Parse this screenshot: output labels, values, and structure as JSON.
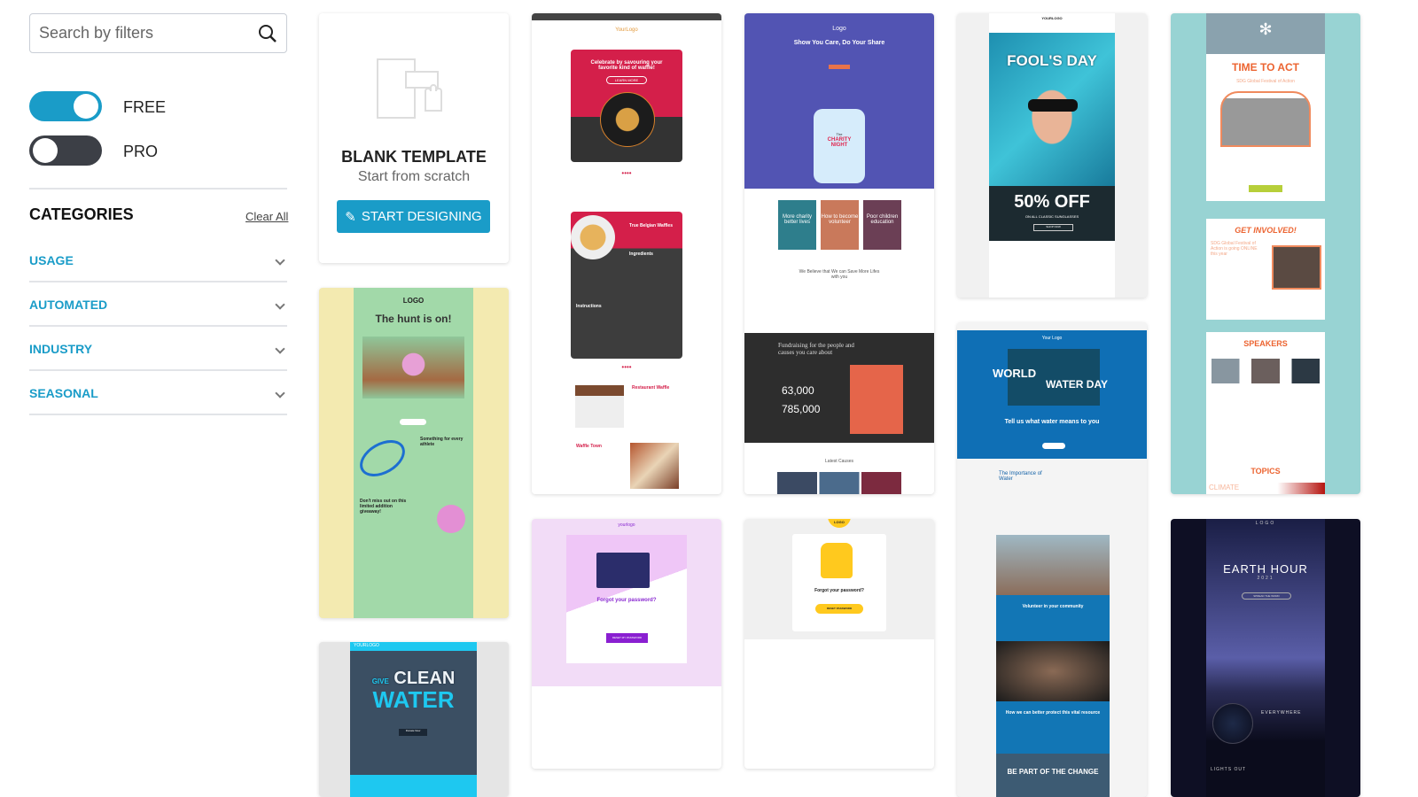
{
  "search": {
    "placeholder": "Search by filters",
    "icon": "search-icon"
  },
  "filters": [
    {
      "label": "FREE",
      "on": true
    },
    {
      "label": "PRO",
      "on": false
    }
  ],
  "colors": {
    "accent": "#1a9cc8",
    "toggle_off": "#3c3f46"
  },
  "categories": {
    "title": "CATEGORIES",
    "clear_label": "Clear All",
    "items": [
      {
        "label": "USAGE"
      },
      {
        "label": "AUTOMATED"
      },
      {
        "label": "INDUSTRY"
      },
      {
        "label": "SEASONAL"
      }
    ]
  },
  "blank": {
    "title": "BLANK TEMPLATE",
    "subtitle": "Start from scratch",
    "button": "START DESIGNING"
  },
  "templates": {
    "easter": {
      "logo": "LOGO",
      "headline": "The hunt is on!",
      "sub1": "Something for every athlete",
      "sub2": "Don't miss out on this limited addition giveaway!",
      "cta": "SHOP NOW"
    },
    "water": {
      "logo": "YOURLOGO",
      "line1": "GIVE",
      "line2": "CLEAN",
      "line3": "WATER",
      "cta": "Donate Now"
    },
    "waffle": {
      "logo": "YourLogo",
      "headline": "Celebrate by savouring your favorite kind of waffle!",
      "cta": "LEARN MORE",
      "recipe": "True Belgian Waffles",
      "ingredients": "Ingredients",
      "instructions": "Instructions",
      "r1": "Restaurant Waffle",
      "r2": "Waffle Town"
    },
    "pw_purple": {
      "logo": "yourlogo",
      "headline": "Forgot your password?",
      "cta": "RESET MY PASSWORD"
    },
    "charity": {
      "logo": "Logo",
      "headline": "Show You Care, Do Your Share",
      "jar1": "The",
      "jar2": "CHARITY NIGHT",
      "tiles": [
        "More charity better lives",
        "How to become volunteer",
        "Poor children education"
      ],
      "believe": "We Believe that We can Save More Lifes with you",
      "fund": "Fundraising for the people and causes you care about",
      "stat1": "63,000",
      "stat2": "785,000",
      "latest": "Latest Causes"
    },
    "pw_yellow": {
      "logo": "LOGO",
      "headline": "Forgot your password?",
      "cta": "RESET PASSWORD"
    },
    "fools": {
      "logo": "YOURLOGO",
      "headline": "FOOL'S DAY",
      "offer": "50% OFF",
      "sub": "ON ALL CLASSIC SUNGLASSES",
      "cta": "SHOP NOW"
    },
    "wwd": {
      "logo": "Your Logo",
      "l1": "WORLD",
      "l2": "WATER DAY",
      "tagline": "Tell us what water means to you",
      "importance": "The Importance of Water",
      "vol": "Volunteer in your community",
      "protect": "How we can better protect this vital resource",
      "change": "BE PART OF THE CHANGE"
    },
    "act": {
      "headline": "TIME TO ACT",
      "sub": "SDG Global Festival of Action",
      "involved": "GET INVOLVED!",
      "involved_sub": "SDG Global Festival of Action is going ONLINE this year",
      "speakers": "SPEAKERS",
      "topics": "TOPICS",
      "climate": "CLIMATE"
    },
    "earth": {
      "logo": "LOGO",
      "headline": "EARTH HOUR",
      "year": "2021",
      "cta": "SPREAD THE WORD",
      "everywhere": "EVERYWHERE",
      "lights": "LIGHTS OUT"
    }
  }
}
